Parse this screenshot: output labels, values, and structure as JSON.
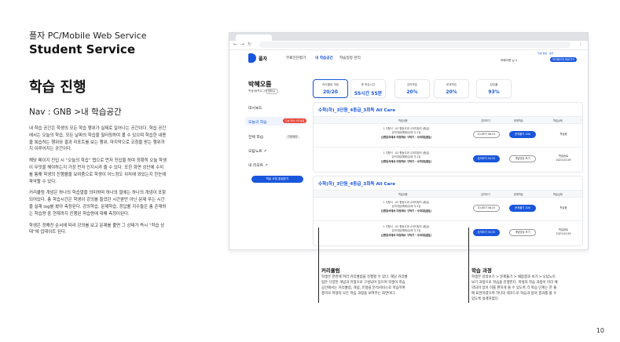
{
  "left": {
    "subtitle": "플자 PC/Mobile Web Service",
    "service": "Student Service",
    "title": "학습 진행",
    "nav": "Nav : GNB >내 학습공간",
    "paragraphs": [
      "내 학습 공간은 학생의 모든 학습 행위가 실제로 일어나는 공간이다. 학습 공간에서는 오늘의 학습, 모든 날짜의 학습을 필터링하여 볼 수 있으며 학습한 내용을 복습하는 행위와 결과 리포트를 보는 행위, 마지막으로 코칭을 받는 행위까지 이루어지는 공간이다.",
      "해당 페이지 진입 시 “오늘의 학습” 탭으로 먼저 진입을 하며 정확히 오늘 학생이 무엇을 해야하는지 가장 먼저 인지시켜 줄 수 있다. 또한 화면 상단에 수치를 통해 학생의 진행률을 보여줌으로 학생이 어느정도 위치에 와있는지 한눈에 파악할 수 있다.",
      "커리큘럼 개념은 하나의 학습열을 의미하며 하나의 열에는 하나의 개념이 포함되어있다. 총 학습시간은 학생이 강의를 들었던 시간뿐만 아닌 문제 푸는 시간을 실제 log를 봤아 측정된다. 강의학습, 문제학습, 정답률 지수들은 총 존재하는 학습량 중 현재까지 진행된 학습량에 대해 측정이된다.",
      "학생은 정해진 순서에 따라 강의를 보고 문제를 풀면 그 상태가 즉시 “학습 상태”에 업데이트 된다."
    ],
    "page_number": "10"
  },
  "site": {
    "logo": "플자",
    "gnb": [
      "무료진단평가",
      "내 학습공간",
      "학습일정 관리"
    ],
    "top_info": "학생 알림 · 공지",
    "user": "박혜오름 님 ∨",
    "mypage_label": "마이페이지 바로가기"
  },
  "sidebar": {
    "name": "박혜오름",
    "grade": "학생(중학교 2학년)",
    "grade_badge": "진행중",
    "items": [
      {
        "label": "대시보드",
        "badge": ""
      },
      {
        "label": "오늘의 학습",
        "badge": "오늘 학습 2개 남음"
      },
      {
        "label": "전체 학습",
        "badge": "학습예정"
      },
      {
        "label": "오답노트 ↗",
        "badge": ""
      },
      {
        "label": "내 리포트 ↗",
        "badge": ""
      }
    ],
    "cta": "학습 코칭 알림받기"
  },
  "stats": [
    {
      "label": "커리큘럼 개념",
      "value": "20/20"
    },
    {
      "label": "총 학습시간",
      "value": "55시간 55분"
    },
    {
      "label": "강의학습",
      "value": "20%"
    },
    {
      "label": "문제학습",
      "value": "20%"
    },
    {
      "label": "정답률",
      "value": "93%"
    }
  ],
  "table_headers": [
    "학습내용",
    "강의보기",
    "문제학습",
    "학습상태"
  ],
  "courses": [
    {
      "title": "수학(하)_3단원_4등급_3회독 All Care",
      "rows": [
        {
          "lines": [
            "1 다항식 - 02 항등식과 나머지정리 (중급)",
            "강의개념/예제/유제 각 2강",
            "[[항등식에서 미정계수 구하기 - 수치대입법]]"
          ],
          "lecture": "다시보기 56:23",
          "problem": "문제풀기 100",
          "problem_style": "outline",
          "status": [
            "학습중"
          ]
        },
        {
          "lines": [
            "1 다항식 - 02 항등식과 나머지정리 (중급)",
            "강의개념/예제/유제 각 2강",
            "[[항등식에서 미정계수 구하기 - 수치대입법]]"
          ],
          "lecture": "강의보기 54:32",
          "problem": "개념영상 보기",
          "problem_style": "outline",
          "status": [
            "학습완료",
            "2023.03.09"
          ]
        }
      ]
    },
    {
      "title": "수학(하)_3단원_4등급_3회독 All Care",
      "rows": [
        {
          "lines": [
            "1 다항식 - 02 항등식과 나머지정리 (중급)",
            "강의개념/예제/유제 각 2강",
            "[[항등식에서 미정계수 구하기 - 수치대입법]]"
          ],
          "lecture": "다시보기 56:23",
          "problem": "문제풀기 100",
          "problem_style": "outline",
          "status": [
            "학습중"
          ]
        },
        {
          "lines": [
            "1 다항식 - 02 항등식과 나머지정리 (중급)",
            "강의개념/예제/유제 각 2강",
            "[[항등식에서 미정계수 구하기 - 수치대입법]]"
          ],
          "lecture": "강의보기 54:32",
          "problem": "개념영상 보기",
          "problem_style": "outline",
          "status": [
            "학습완료",
            "2023.03.09"
          ]
        }
      ]
    }
  ],
  "callouts": [
    {
      "title": "커리큘럼",
      "desc": "학생은 한번에 여러 커리큘럼을 진행할 수 있다. 해당 커리큘럼은 다양한 개념과 유형으로 구성되어 있으며 학생이 학습 공간에서는 커리큘럼, 개념, 유형을 분석서비스로 학습하여 흥미로 학생의 모든 학습 과정을 보여주는 화면이다."
    },
    {
      "title": "학습 과정",
      "desc": "학생은 강의보기 > 문제풀기 > 채점결과 보기 > 오답노트 보기 과정으로 학습을 진행한다. 학생의 학습 과정이 미리 예약되어 있어 이를 편하게 볼 수 있도록 각 학습 단계는 한 줄에 표현하였으며 하나의 레코드로 학습과 정의 결과를 볼 수 있도록 설계하였다."
    }
  ]
}
